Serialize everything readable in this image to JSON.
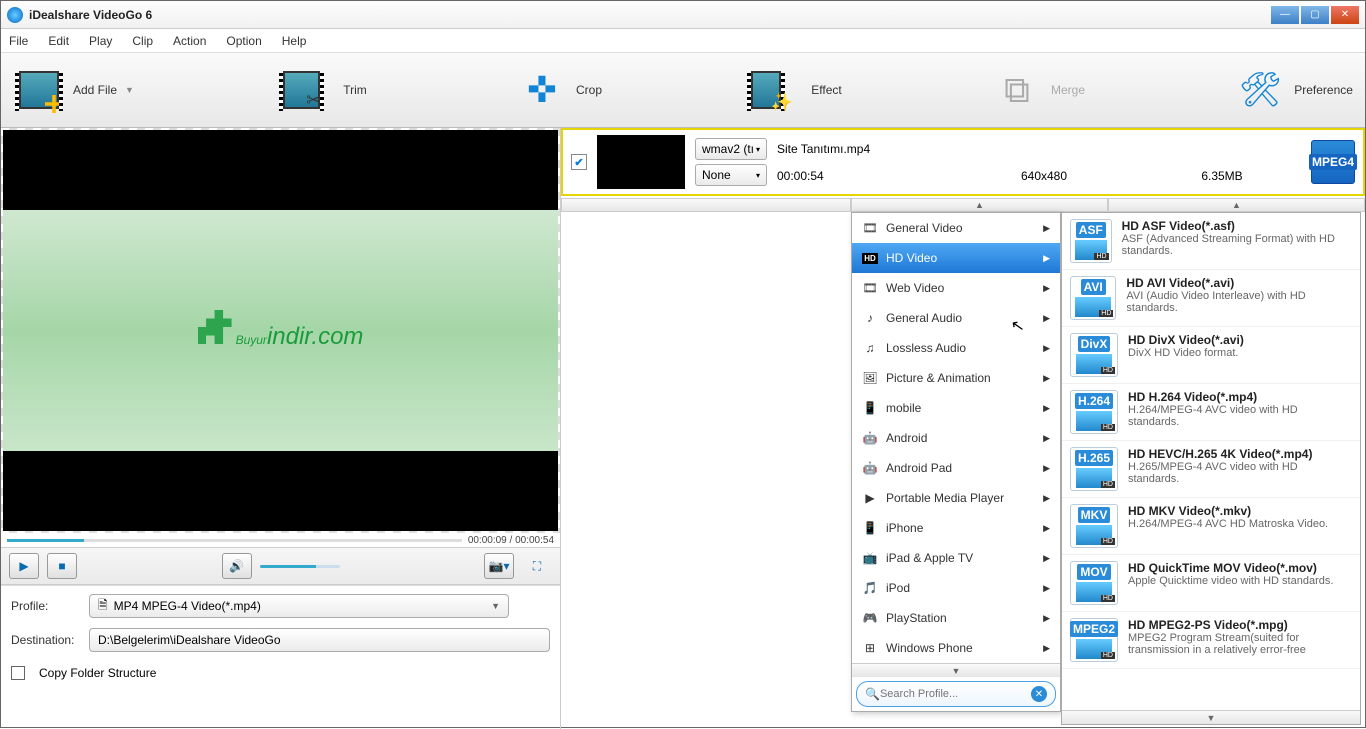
{
  "titlebar": {
    "title": "iDealshare VideoGo 6"
  },
  "menu": [
    "File",
    "Edit",
    "Play",
    "Clip",
    "Action",
    "Option",
    "Help"
  ],
  "toolbar": {
    "addfile": "Add File",
    "trim": "Trim",
    "crop": "Crop",
    "effect": "Effect",
    "merge": "Merge",
    "preference": "Preference"
  },
  "preview": {
    "brand_big": "Buyur",
    "brand_small": "indir.com",
    "time": "00:00:09 / 00:00:54"
  },
  "profile": {
    "label": "Profile:",
    "value": "MP4 MPEG-4 Video(*.mp4)"
  },
  "destination": {
    "label": "Destination:",
    "value": "D:\\Belgelerim\\iDealshare VideoGo"
  },
  "copyfolder": "Copy Folder Structure",
  "file": {
    "name": "Site Tanıtımı.mp4",
    "codec": "wmav2 (tı",
    "subs": "None",
    "duration": "00:00:54",
    "resolution": "640x480",
    "size": "6.35MB",
    "format": "MPEG4"
  },
  "categories": [
    {
      "icon": "🎞",
      "label": "General Video"
    },
    {
      "icon": "HD",
      "label": "HD Video",
      "selected": true
    },
    {
      "icon": "🎞",
      "label": "Web Video"
    },
    {
      "icon": "♪",
      "label": "General Audio"
    },
    {
      "icon": "♫",
      "label": "Lossless Audio"
    },
    {
      "icon": "🖼",
      "label": "Picture & Animation"
    },
    {
      "icon": "📱",
      "label": "mobile"
    },
    {
      "icon": "🤖",
      "label": "Android"
    },
    {
      "icon": "🤖",
      "label": "Android Pad"
    },
    {
      "icon": "▶",
      "label": "Portable Media Player"
    },
    {
      "icon": "📱",
      "label": "iPhone"
    },
    {
      "icon": "📺",
      "label": "iPad & Apple TV"
    },
    {
      "icon": "🎵",
      "label": "iPod"
    },
    {
      "icon": "🎮",
      "label": "PlayStation"
    },
    {
      "icon": "⊞",
      "label": "Windows Phone"
    }
  ],
  "search_placeholder": "Search Profile...",
  "formats": [
    {
      "tag": "ASF",
      "title": "HD ASF Video(*.asf)",
      "desc": "ASF (Advanced Streaming Format) with HD standards."
    },
    {
      "tag": "AVI",
      "title": "HD AVI Video(*.avi)",
      "desc": "AVI (Audio Video Interleave) with HD standards."
    },
    {
      "tag": "DivX",
      "title": "HD DivX Video(*.avi)",
      "desc": "DivX HD Video format."
    },
    {
      "tag": "H.264",
      "title": "HD H.264 Video(*.mp4)",
      "desc": "H.264/MPEG-4 AVC video with HD standards."
    },
    {
      "tag": "H.265",
      "title": "HD HEVC/H.265 4K Video(*.mp4)",
      "desc": "H.265/MPEG-4 AVC video with HD standards."
    },
    {
      "tag": "MKV",
      "title": "HD MKV Video(*.mkv)",
      "desc": "H.264/MPEG-4 AVC HD Matroska Video."
    },
    {
      "tag": "MOV",
      "title": "HD QuickTime MOV Video(*.mov)",
      "desc": "Apple Quicktime video with HD standards."
    },
    {
      "tag": "MPEG2",
      "title": "HD MPEG2-PS Video(*.mpg)",
      "desc": "MPEG2 Program Stream(suited for transmission in a relatively error-free"
    }
  ]
}
